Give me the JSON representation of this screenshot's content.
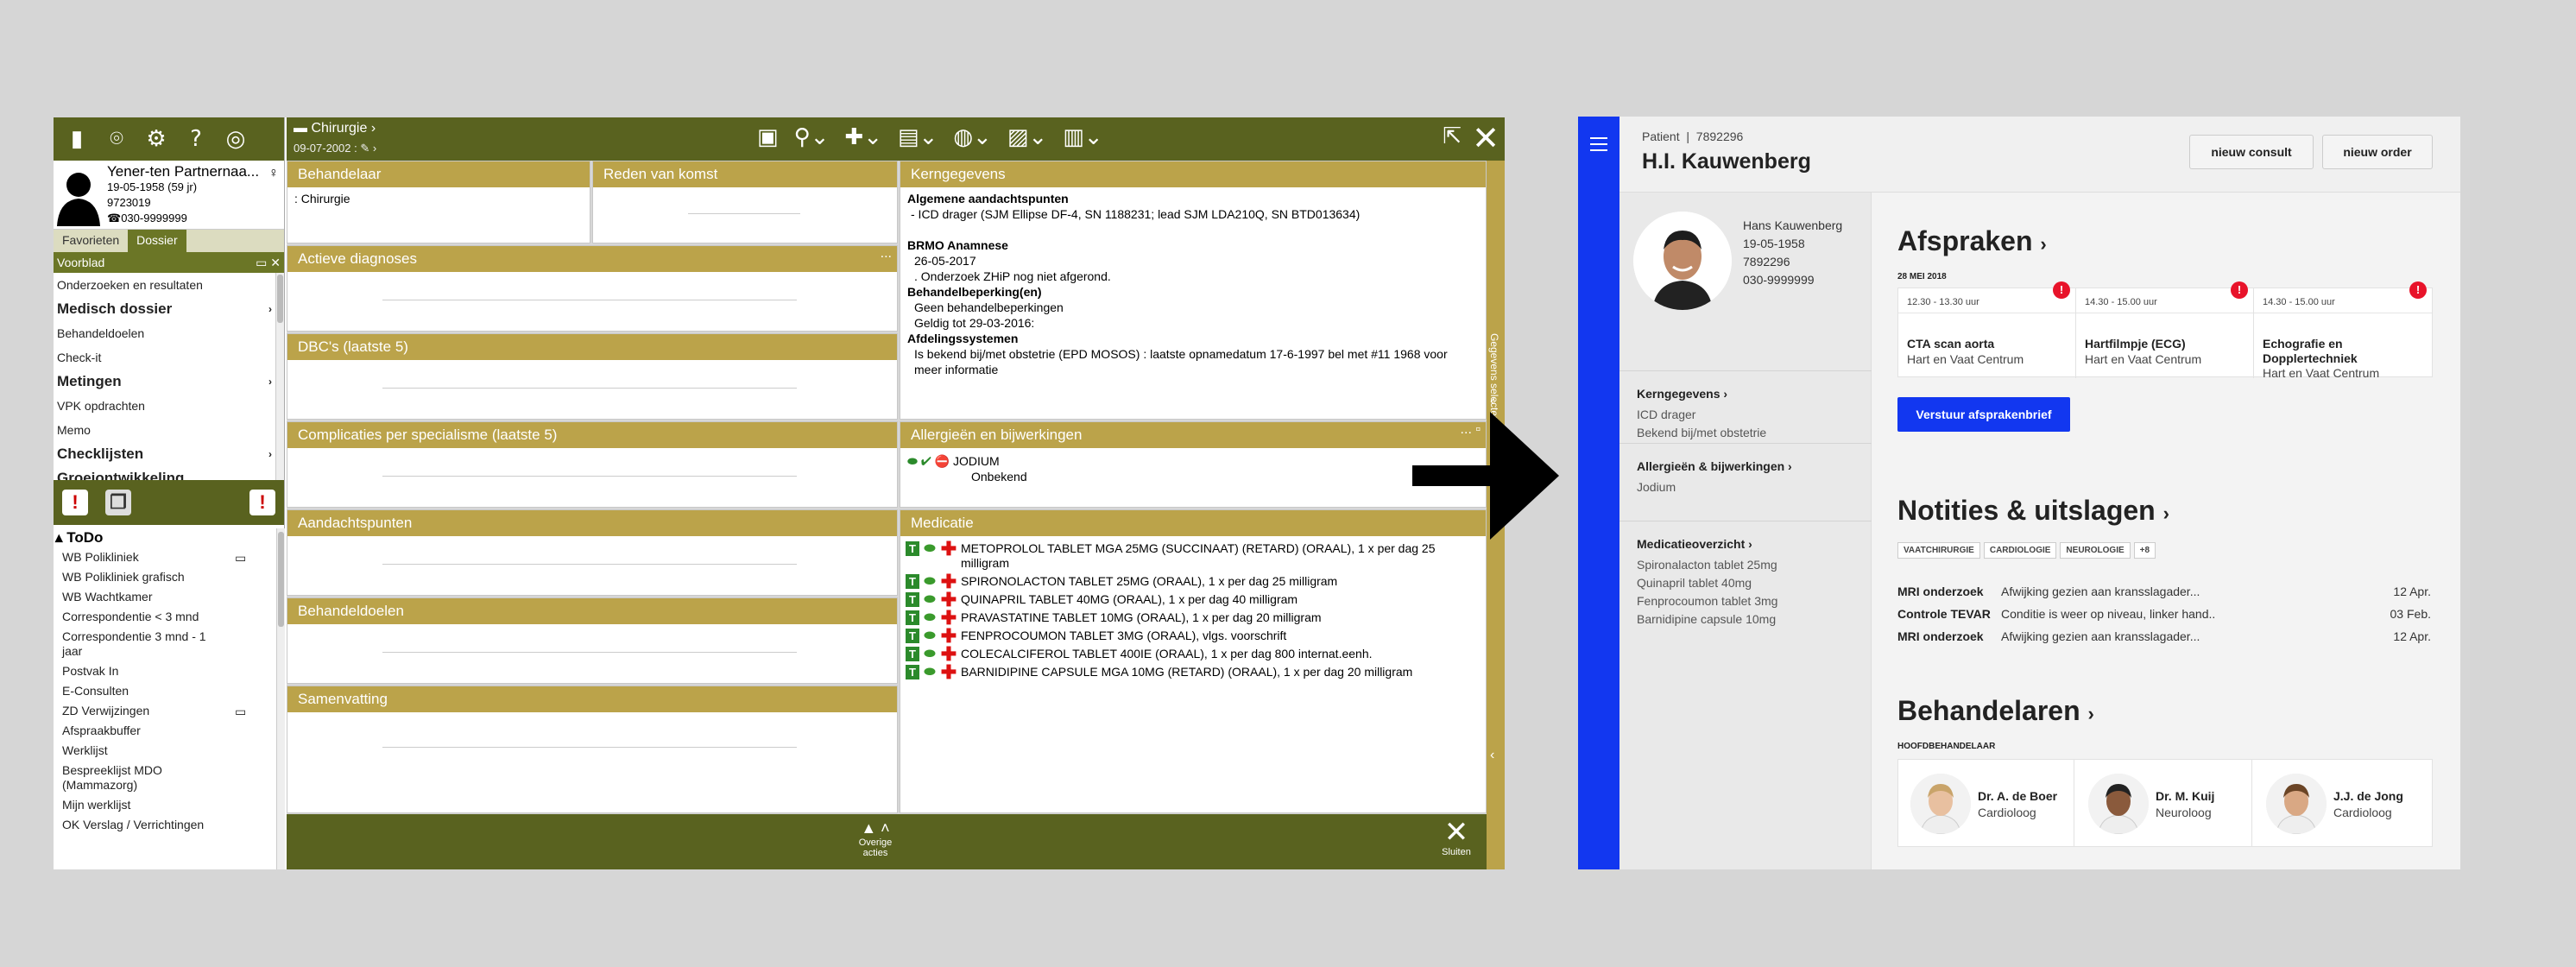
{
  "old_app": {
    "patient": {
      "name": "Yener-ten Partnernaa...",
      "dob": "19-05-1958 (59 jr)",
      "id": "9723019",
      "phone": "030-9999999"
    },
    "tabs": [
      "Favorieten",
      "Dossier"
    ],
    "active_item": "Voorblad",
    "menu": [
      {
        "label": "Onderzoeken en resultaten",
        "bold": false,
        "arrow": false
      },
      {
        "label": "Medisch dossier",
        "bold": true,
        "arrow": true
      },
      {
        "label": "Behandeldoelen",
        "bold": false,
        "arrow": false
      },
      {
        "label": "Check-it",
        "bold": false,
        "arrow": false
      },
      {
        "label": "Metingen",
        "bold": true,
        "arrow": true
      },
      {
        "label": "VPK opdrachten",
        "bold": false,
        "arrow": false
      },
      {
        "label": "Memo",
        "bold": false,
        "arrow": false
      },
      {
        "label": "Checklijsten",
        "bold": true,
        "arrow": true
      },
      {
        "label": "Groeiontwikkeling",
        "bold": true,
        "arrow": false
      }
    ],
    "todo_title": "ToDo",
    "todo_items": [
      {
        "label": "WB Polikliniek",
        "monitor": true
      },
      {
        "label": "WB Polikliniek grafisch",
        "monitor": false
      },
      {
        "label": "WB Wachtkamer",
        "monitor": false
      },
      {
        "label": "Correspondentie < 3 mnd",
        "monitor": false
      },
      {
        "label": "Correspondentie 3 mnd - 1 jaar",
        "monitor": false
      },
      {
        "label": "Postvak In",
        "monitor": false
      },
      {
        "label": "E-Consulten",
        "monitor": false
      },
      {
        "label": "ZD Verwijzingen",
        "monitor": true
      },
      {
        "label": "Afspraakbuffer",
        "monitor": false
      },
      {
        "label": "Werklijst",
        "monitor": false
      },
      {
        "label": "Bespreeklijst MDO (Mammazorg)",
        "monitor": false
      },
      {
        "label": "Mijn werklijst",
        "monitor": false
      },
      {
        "label": "OK Verslag / Verrichtingen",
        "monitor": false
      }
    ],
    "context": {
      "dept": "Chirurgie",
      "date": "09-07-2002"
    },
    "panels": {
      "behandelaar": {
        "title": "Behandelaar",
        "value": ":  Chirurgie"
      },
      "reden": {
        "title": "Reden van komst"
      },
      "diagnoses": {
        "title": "Actieve diagnoses"
      },
      "dbc": {
        "title": "DBC's (laatste 5)"
      },
      "complicaties": {
        "title": "Complicaties per specialisme (laatste 5)"
      },
      "aandacht": {
        "title": "Aandachtspunten"
      },
      "doelen": {
        "title": "Behandeldoelen"
      },
      "samenvatting": {
        "title": "Samenvatting"
      },
      "kern": {
        "title": "Kerngegevens",
        "h1": "Algemene aandachtspunten",
        "l1": "- ICD drager (SJM Ellipse DF-4, SN 1188231; lead SJM LDA210Q, SN BTD013634)",
        "h2": "BRMO Anamnese",
        "l2a": "26-05-2017",
        "l2b": ". Onderzoek ZHiP nog niet afgerond.",
        "h3": "Behandelbeperking(en)",
        "l3a": "Geen behandelbeperkingen",
        "l3b": "Geldig tot 29-03-2016:",
        "h4": "Afdelingssystemen",
        "l4": "Is bekend bij/met obstetrie (EPD MOSOS) : laatste opnamedatum 17-6-1997 bel met #11 1968 voor meer informatie"
      },
      "allergie": {
        "title": "Allergieën en bijwerkingen",
        "name": "JODIUM",
        "status": "Onbekend"
      },
      "medicatie": {
        "title": "Medicatie",
        "items": [
          "METOPROLOL TABLET MGA  25MG (SUCCINAAT) (RETARD)  (ORAAL), 1 x per dag 25 milligram",
          "SPIRONOLACTON TABLET 25MG  (ORAAL), 1 x per dag 25 milligram",
          "QUINAPRIL TABLET 40MG  (ORAAL), 1 x per dag 40 milligram",
          "PRAVASTATINE TABLET 10MG  (ORAAL), 1 x per dag 20 milligram",
          "FENPROCOUMON TABLET 3MG  (ORAAL), vlgs. voorschrift",
          "COLECALCIFEROL TABLET   400IE  (ORAAL), 1 x per dag 800 internat.eenh.",
          "BARNIDIPINE CAPSULE MGA 10MG (RETARD)  (ORAAL), 1 x per dag 20 milligram"
        ]
      }
    },
    "bottom": {
      "overige": "Overige acties",
      "sluiten": "Sluiten"
    },
    "side_strip": "Gegevens selecteren"
  },
  "new_app": {
    "patient_label": "Patient",
    "patient_id": "7892296",
    "patient_name": "H.I. Kauwenberg",
    "buttons": {
      "consult": "nieuw consult",
      "order": "nieuw order"
    },
    "info": {
      "name": "Hans Kauwenberg",
      "dob": "19-05-1958",
      "id": "7892296",
      "phone": "030-9999999"
    },
    "sections": [
      {
        "title": "Kerngegevens",
        "lines": [
          "ICD drager",
          "Bekend bij/met obstetrie"
        ]
      },
      {
        "title": "Allergieën & bijwerkingen",
        "lines": [
          "Jodium"
        ]
      },
      {
        "title": "Medicatieoverzicht",
        "lines": [
          "Spironalacton tablet 25mg",
          "Quinapril tablet 40mg",
          "Fenprocoumon tablet 3mg",
          "Barnidipine capsule 10mg"
        ]
      }
    ],
    "afspraken": {
      "title": "Afspraken",
      "date": "28 MEI 2018",
      "items": [
        {
          "time": "12.30 - 13.30 uur",
          "name": "CTA scan aorta",
          "loc": "Hart en Vaat Centrum"
        },
        {
          "time": "14.30 - 15.00 uur",
          "name": "Hartfilmpje (ECG)",
          "loc": "Hart en Vaat Centrum"
        },
        {
          "time": "14.30 - 15.00 uur",
          "name": "Echografie en Dopplertechniek",
          "loc": "Hart en Vaat Centrum"
        }
      ],
      "send": "Verstuur afsprakenbrief"
    },
    "notities": {
      "title": "Notities & uitslagen",
      "tags": [
        "VAATCHIRURGIE",
        "CARDIOLOGIE",
        "NEUROLOGIE",
        "+8"
      ],
      "rows": [
        {
          "type": "MRI onderzoek",
          "desc": "Afwijking gezien aan kransslagader...",
          "date": "12 Apr."
        },
        {
          "type": "Controle TEVAR",
          "desc": "Conditie is weer op niveau, linker hand..",
          "date": "03 Feb."
        },
        {
          "type": "MRI onderzoek",
          "desc": "Afwijking gezien aan kransslagader...",
          "date": "12 Apr."
        }
      ]
    },
    "behandelaren": {
      "title": "Behandelaren",
      "sub": "HOOFDBEHANDELAAR",
      "docs": [
        {
          "name": "Dr. A. de Boer",
          "role": "Cardioloog"
        },
        {
          "name": "Dr. M. Kuij",
          "role": "Neuroloog"
        },
        {
          "name": "J.J. de Jong",
          "role": "Cardioloog"
        }
      ]
    }
  }
}
